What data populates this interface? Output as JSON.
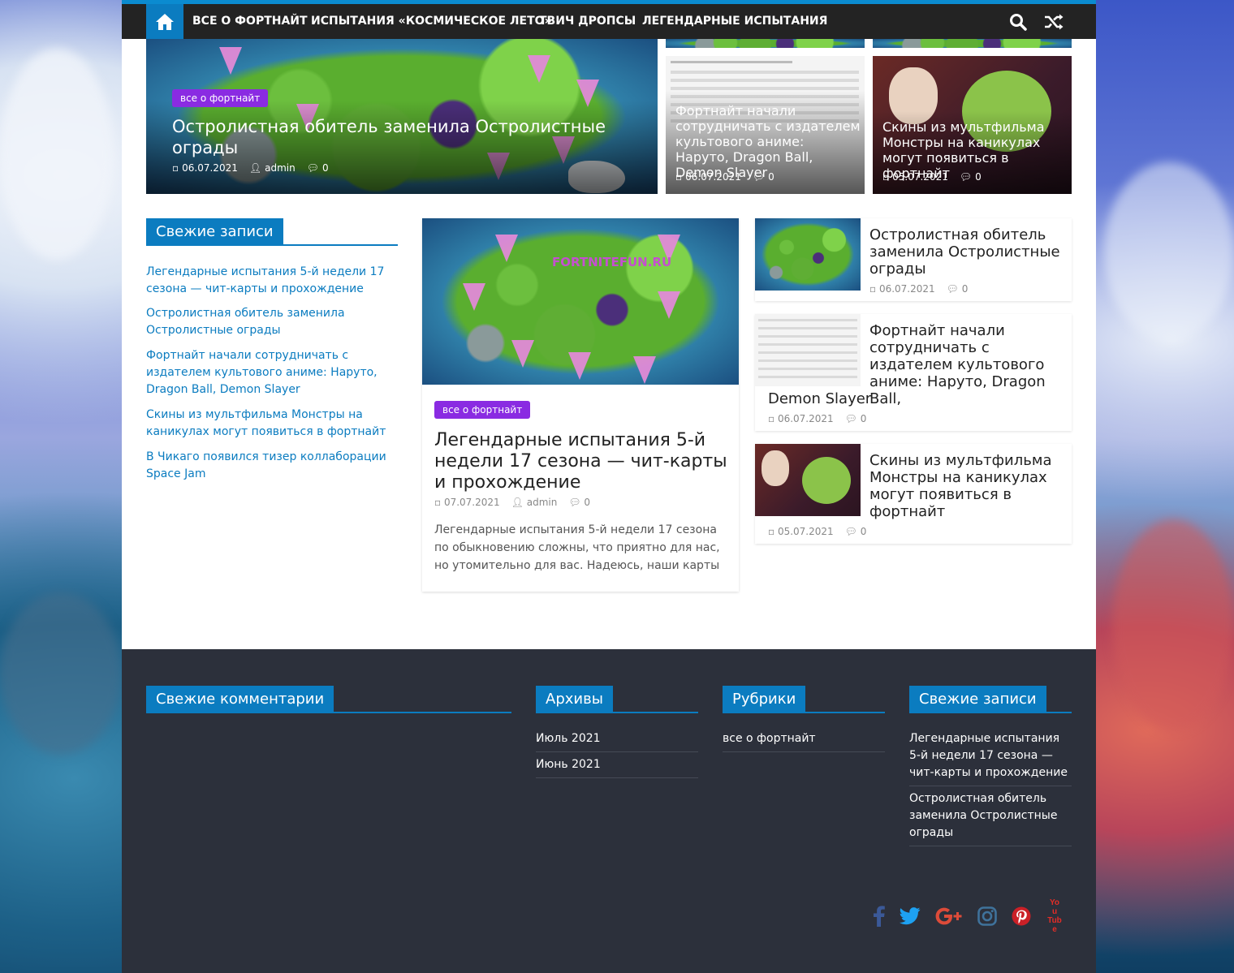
{
  "colors": {
    "accent": "#0b7cc0",
    "badge": "#8a2be2",
    "nav_bg": "#232323",
    "footer_bg": "#2c303b",
    "facebook": "#3b5998",
    "twitter": "#1da1f2",
    "google_plus": "#dd4b39",
    "instagram": "#3f729b",
    "pinterest": "#cb2027",
    "youtube": "#e52d27"
  },
  "nav": {
    "home_icon": "home-icon",
    "items": [
      "ВСЕ О ФОРТНАЙТ",
      "ИСПЫТАНИЯ «КОСМИЧЕСКОЕ ЛЕТО»",
      "ТВИЧ ДРОПСЫ",
      "ЛЕГЕНДАРНЫЕ ИСПЫТАНИЯ"
    ],
    "search_icon": "search-icon",
    "random_icon": "shuffle-icon"
  },
  "featured": {
    "main": {
      "badge": "все о фортнайт",
      "title": "Остролистная обитель заменила Остролистные ограды",
      "date": "06.07.2021",
      "author": "admin",
      "comments": "0"
    },
    "card2": {
      "title": "Фортнайт начали сотрудничать с издателем культового аниме: Наруто, Dragon Ball, Demon Slayer",
      "date": "06.07.2021",
      "comments": "0"
    },
    "card3": {
      "title": "Скины из мультфильма Монстры на каникулах могут появиться в фортнайт",
      "date": "05.07.2021",
      "comments": "0"
    }
  },
  "sidebar": {
    "title": "Свежие записи",
    "links": [
      "Легендарные испытания 5-й недели 17 сезона — чит-карты и прохождение",
      "Остролистная обитель заменила Остролистные ограды",
      "Фортнайт начали сотрудничать с издателем культового аниме: Наруто, Dragon Ball, Demon Slayer",
      "Скины из мультфильма Монстры на каникулах могут появиться в фортнайт",
      "В Чикаго появился тизер коллаборации Space Jam"
    ]
  },
  "main_post": {
    "image_text": "FORTNITEFUN.RU",
    "badge": "все о фортнайт",
    "title": "Легендарные испытания 5-й недели 17 сезона — чит-карты и прохождение",
    "date": "07.07.2021",
    "author": "admin",
    "comments": "0",
    "excerpt": "Легендарные испытания 5-й недели 17 сезона по обыкновению сложны, что приятно для нас, но утомительно для вас. Надеюсь, наши карты"
  },
  "right_list": [
    {
      "title": "Остролистная обитель заменила Остролистные ограды",
      "date": "06.07.2021",
      "comments": "0"
    },
    {
      "title": "Фортнайт начали сотрудничать с издателем культового аниме: Наруто, Dragon Ball,",
      "title_tail": "Demon Slayer",
      "date": "06.07.2021",
      "comments": "0"
    },
    {
      "title": "Скины из мультфильма Монстры на каникулах могут появиться в фортнайт",
      "date": "05.07.2021",
      "comments": "0"
    }
  ],
  "footer": {
    "comments_title": "Свежие комментарии",
    "archives_title": "Архивы",
    "archives": [
      "Июль 2021",
      "Июнь 2021"
    ],
    "rubrics_title": "Рубрики",
    "rubrics": [
      "все о фортнайт"
    ],
    "recent_title": "Свежие записи",
    "recent": [
      "Легендарные испытания 5-й недели 17 сезона — чит-карты и прохождение",
      "Остролистная обитель заменила Остролистные ограды"
    ],
    "social": [
      "facebook-icon",
      "twitter-icon",
      "google-plus-icon",
      "instagram-icon",
      "pinterest-icon",
      "youtube-icon"
    ],
    "youtube_label": "You Tube"
  }
}
